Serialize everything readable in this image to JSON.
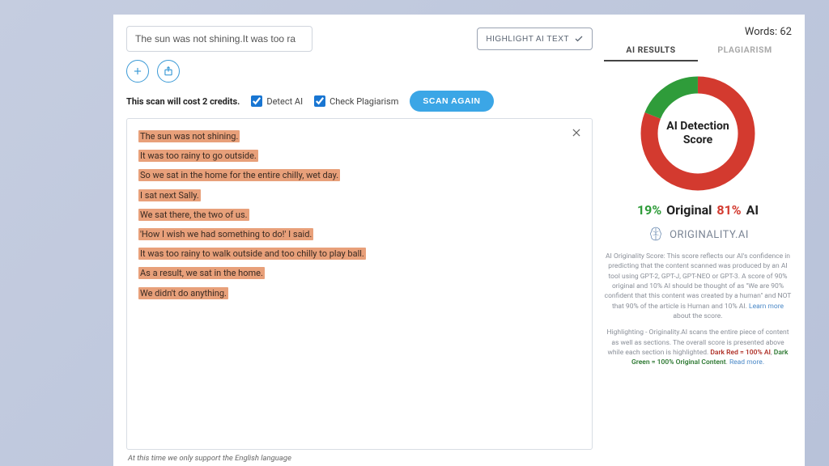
{
  "header": {
    "title_input_value": "The sun was not shining.It was too ra",
    "highlight_button": "HIGHLIGHT AI TEXT"
  },
  "options": {
    "credits_text": "This scan will cost 2 credits.",
    "detect_ai_label": "Detect AI",
    "check_plagiarism_label": "Check Plagiarism",
    "scan_button": "SCAN AGAIN"
  },
  "editor": {
    "lines": [
      "The sun was not shining.",
      "It was too rainy to go outside.",
      "So we sat in the home for the entire chilly, wet day.",
      "I sat next Sally.",
      "We sat there, the two of us.",
      "'How I wish we had something to do!' I said.",
      "It was too rainy to walk outside and too chilly to play ball.",
      "As a result, we sat in the home.",
      "We didn't do anything."
    ],
    "footnote": "At this time we only support the English language"
  },
  "results": {
    "words_label": "Words:",
    "words_count": "62",
    "tabs": {
      "ai": "AI RESULTS",
      "plagiarism": "PLAGIARISM"
    },
    "donut_title_line1": "AI Detection",
    "donut_title_line2": "Score",
    "original_pct": "19%",
    "original_label": "Original",
    "ai_pct": "81%",
    "ai_label": "AI",
    "brand": "ORIGINALITY.AI",
    "desc1_a": "AI Originality Score: This score reflects our AI's confidence in predicting that the content scanned was produced by an AI tool using GPT-2, GPT-J, GPT-NEO or GPT-3. A score of 90% original and 10% AI should be thought of as \"We are 90% confident that this content was created by a human\" and NOT that 90% of the article is Human and 10% AI. ",
    "desc1_link": "Learn more",
    "desc1_after": " about the score.",
    "desc2_a": "Highlighting - Originality.AI scans the entire piece of content as well as sections. The overall score is presented above while each section is highlighted. ",
    "desc2_red": "Dark Red = 100% AI",
    "desc2_sep": ", ",
    "desc2_green": "Dark Green = 100% Original Content",
    "desc2_end": ". ",
    "desc2_link": "Read more."
  },
  "chart_data": {
    "type": "pie",
    "title": "AI Detection Score",
    "series": [
      {
        "name": "Original",
        "value": 19,
        "color": "#2f9c3a"
      },
      {
        "name": "AI",
        "value": 81,
        "color": "#d33a2f"
      }
    ]
  }
}
